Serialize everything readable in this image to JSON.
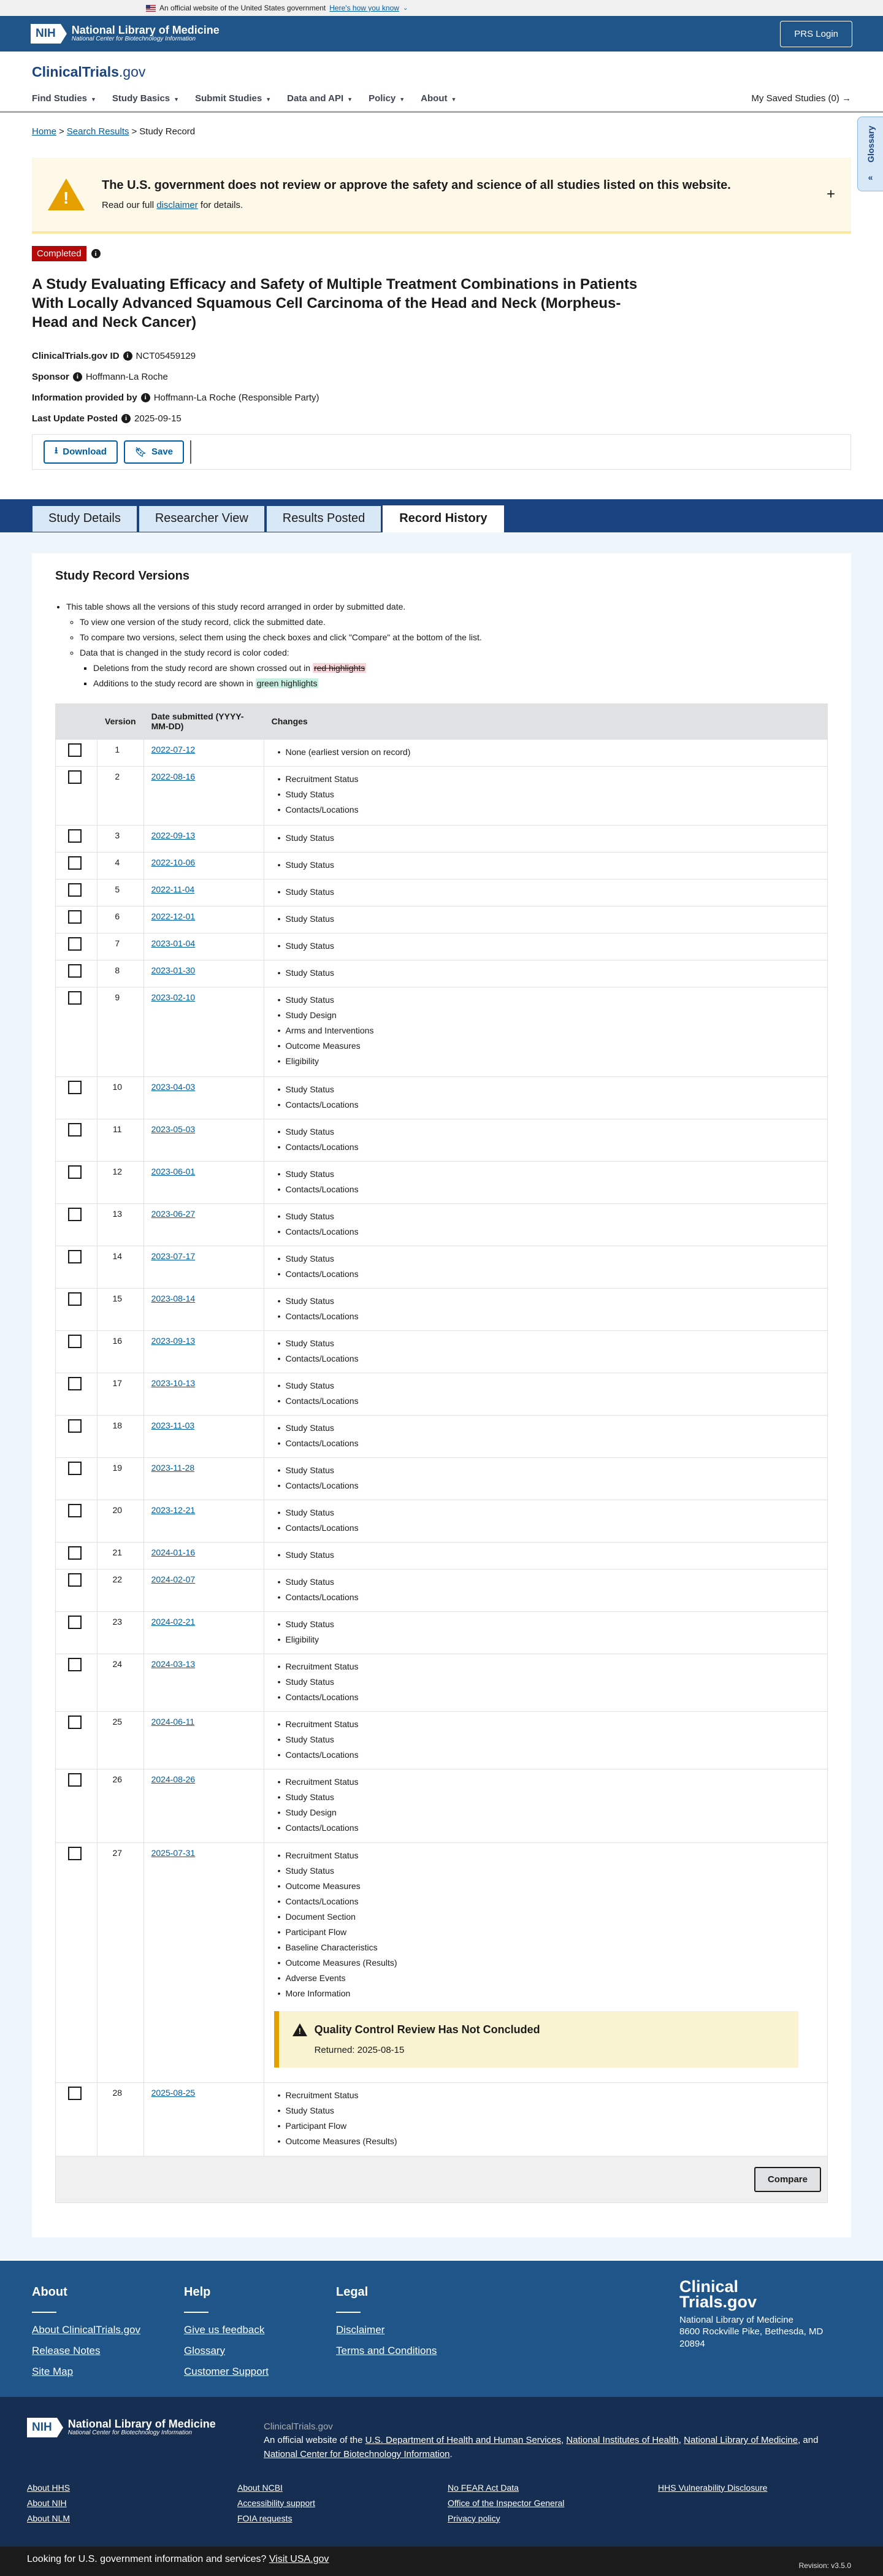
{
  "gov_banner": {
    "text": "An official website of the United States government",
    "how": "Here's how you know"
  },
  "nlm": {
    "nih": "NIH",
    "title": "National Library of Medicine",
    "subtitle": "National Center for Biotechnology Information",
    "prs_login": "PRS Login"
  },
  "site": {
    "logo": "ClinicalTrials",
    "logo_suffix": ".gov"
  },
  "nav": {
    "items": [
      "Find Studies",
      "Study Basics",
      "Submit Studies",
      "Data and API",
      "Policy",
      "About"
    ],
    "saved": "My Saved Studies (0)"
  },
  "glossary": "Glossary",
  "breadcrumb": {
    "home": "Home",
    "search": "Search Results",
    "current": "Study Record"
  },
  "disclaimer": {
    "title": "The U.S. government does not review or approve the safety and science of all studies listed on this website.",
    "pre": "Read our full",
    "link": "disclaimer",
    "post": "for details."
  },
  "study": {
    "status": "Completed",
    "title": "A Study Evaluating Efficacy and Safety of Multiple Treatment Combinations in Patients With Locally Advanced Squamous Cell Carcinoma of the Head and Neck (Morpheus-Head and Neck Cancer)",
    "id_label": "ClinicalTrials.gov ID",
    "id": "NCT05459129",
    "sponsor_label": "Sponsor",
    "sponsor": "Hoffmann-La Roche",
    "info_label": "Information provided by",
    "info": "Hoffmann-La Roche (Responsible Party)",
    "update_label": "Last Update Posted",
    "update": "2025-09-15"
  },
  "actions": {
    "download": "Download",
    "save": "Save"
  },
  "tabs": [
    "Study Details",
    "Researcher View",
    "Results Posted",
    "Record History"
  ],
  "history": {
    "title": "Study Record Versions",
    "intro": {
      "l1": "This table shows all the versions of this study record arranged in order by submitted date.",
      "l2": "To view one version of the study record, click the submitted date.",
      "l3": "To compare two versions, select them using the check boxes and click \"Compare\" at the bottom of the list.",
      "l4": "Data that is changed in the study record is color coded:",
      "l5": "Deletions from the study record are shown crossed out in",
      "l5_hl": "red highlights",
      "l6": "Additions to the study record are shown in",
      "l6_hl": "green highlights"
    },
    "headers": {
      "version": "Version",
      "date": "Date submitted (YYYY-MM-DD)",
      "changes": "Changes"
    },
    "rows": [
      {
        "v": 1,
        "d": "2022-07-12",
        "c": [
          "None (earliest version on record)"
        ]
      },
      {
        "v": 2,
        "d": "2022-08-16",
        "c": [
          "Recruitment Status",
          "Study Status",
          "Contacts/Locations"
        ]
      },
      {
        "v": 3,
        "d": "2022-09-13",
        "c": [
          "Study Status"
        ]
      },
      {
        "v": 4,
        "d": "2022-10-06",
        "c": [
          "Study Status"
        ]
      },
      {
        "v": 5,
        "d": "2022-11-04",
        "c": [
          "Study Status"
        ]
      },
      {
        "v": 6,
        "d": "2022-12-01",
        "c": [
          "Study Status"
        ]
      },
      {
        "v": 7,
        "d": "2023-01-04",
        "c": [
          "Study Status"
        ]
      },
      {
        "v": 8,
        "d": "2023-01-30",
        "c": [
          "Study Status"
        ]
      },
      {
        "v": 9,
        "d": "2023-02-10",
        "c": [
          "Study Status",
          "Study Design",
          "Arms and Interventions",
          "Outcome Measures",
          "Eligibility"
        ]
      },
      {
        "v": 10,
        "d": "2023-04-03",
        "c": [
          "Study Status",
          "Contacts/Locations"
        ]
      },
      {
        "v": 11,
        "d": "2023-05-03",
        "c": [
          "Study Status",
          "Contacts/Locations"
        ]
      },
      {
        "v": 12,
        "d": "2023-06-01",
        "c": [
          "Study Status",
          "Contacts/Locations"
        ]
      },
      {
        "v": 13,
        "d": "2023-06-27",
        "c": [
          "Study Status",
          "Contacts/Locations"
        ]
      },
      {
        "v": 14,
        "d": "2023-07-17",
        "c": [
          "Study Status",
          "Contacts/Locations"
        ]
      },
      {
        "v": 15,
        "d": "2023-08-14",
        "c": [
          "Study Status",
          "Contacts/Locations"
        ]
      },
      {
        "v": 16,
        "d": "2023-09-13",
        "c": [
          "Study Status",
          "Contacts/Locations"
        ]
      },
      {
        "v": 17,
        "d": "2023-10-13",
        "c": [
          "Study Status",
          "Contacts/Locations"
        ]
      },
      {
        "v": 18,
        "d": "2023-11-03",
        "c": [
          "Study Status",
          "Contacts/Locations"
        ]
      },
      {
        "v": 19,
        "d": "2023-11-28",
        "c": [
          "Study Status",
          "Contacts/Locations"
        ]
      },
      {
        "v": 20,
        "d": "2023-12-21",
        "c": [
          "Study Status",
          "Contacts/Locations"
        ]
      },
      {
        "v": 21,
        "d": "2024-01-16",
        "c": [
          "Study Status"
        ]
      },
      {
        "v": 22,
        "d": "2024-02-07",
        "c": [
          "Study Status",
          "Contacts/Locations"
        ]
      },
      {
        "v": 23,
        "d": "2024-02-21",
        "c": [
          "Study Status",
          "Eligibility"
        ]
      },
      {
        "v": 24,
        "d": "2024-03-13",
        "c": [
          "Recruitment Status",
          "Study Status",
          "Contacts/Locations"
        ]
      },
      {
        "v": 25,
        "d": "2024-06-11",
        "c": [
          "Recruitment Status",
          "Study Status",
          "Contacts/Locations"
        ]
      },
      {
        "v": 26,
        "d": "2024-08-26",
        "c": [
          "Recruitment Status",
          "Study Status",
          "Study Design",
          "Contacts/Locations"
        ]
      },
      {
        "v": 27,
        "d": "2025-07-31",
        "c": [
          "Recruitment Status",
          "Study Status",
          "Outcome Measures",
          "Contacts/Locations",
          "Document Section",
          "Participant Flow",
          "Baseline Characteristics",
          "Outcome Measures (Results)",
          "Adverse Events",
          "More Information"
        ],
        "qc": {
          "title": "Quality Control Review Has Not Concluded",
          "returned": "Returned: 2025-08-15"
        }
      },
      {
        "v": 28,
        "d": "2025-08-25",
        "c": [
          "Recruitment Status",
          "Study Status",
          "Participant Flow",
          "Outcome Measures (Results)"
        ]
      }
    ],
    "compare": "Compare"
  },
  "footer": {
    "about": {
      "title": "About",
      "links": [
        "About ClinicalTrials.gov",
        "Release Notes",
        "Site Map"
      ]
    },
    "help": {
      "title": "Help",
      "links": [
        "Give us feedback",
        "Glossary",
        "Customer Support"
      ]
    },
    "legal": {
      "title": "Legal",
      "links": [
        "Disclaimer",
        "Terms and Conditions"
      ]
    },
    "ct": {
      "logo1": "Clinical",
      "logo2": "Trials.gov",
      "a1": "National Library of Medicine",
      "a2": "8600 Rockville Pike, Bethesda, MD",
      "a3": "20894"
    },
    "nlm": {
      "nih": "NIH",
      "title": "National Library of Medicine",
      "subtitle": "National Center for Biotechnology Information"
    },
    "cg": "ClinicalTrials.gov",
    "official_pre": "An official website of the",
    "hhs": "U.S. Department of Health and Human Services",
    "nih_link": "National Institutes of Health",
    "nlm_link": "National Library of Medicine",
    "and": "and",
    "ncbi": "National Center for Biotechnology Information",
    "links": [
      "About HHS",
      "About NCBI",
      "No FEAR Act Data",
      "HHS Vulnerability Disclosure",
      "About NIH",
      "Accessibility support",
      "Office of the Inspector General",
      "",
      "About NLM",
      "FOIA requests",
      "Privacy policy",
      ""
    ],
    "usa_pre": "Looking for U.S. government information and services?",
    "usa": "Visit USA.gov",
    "version": "Revision: v3.5.0"
  }
}
